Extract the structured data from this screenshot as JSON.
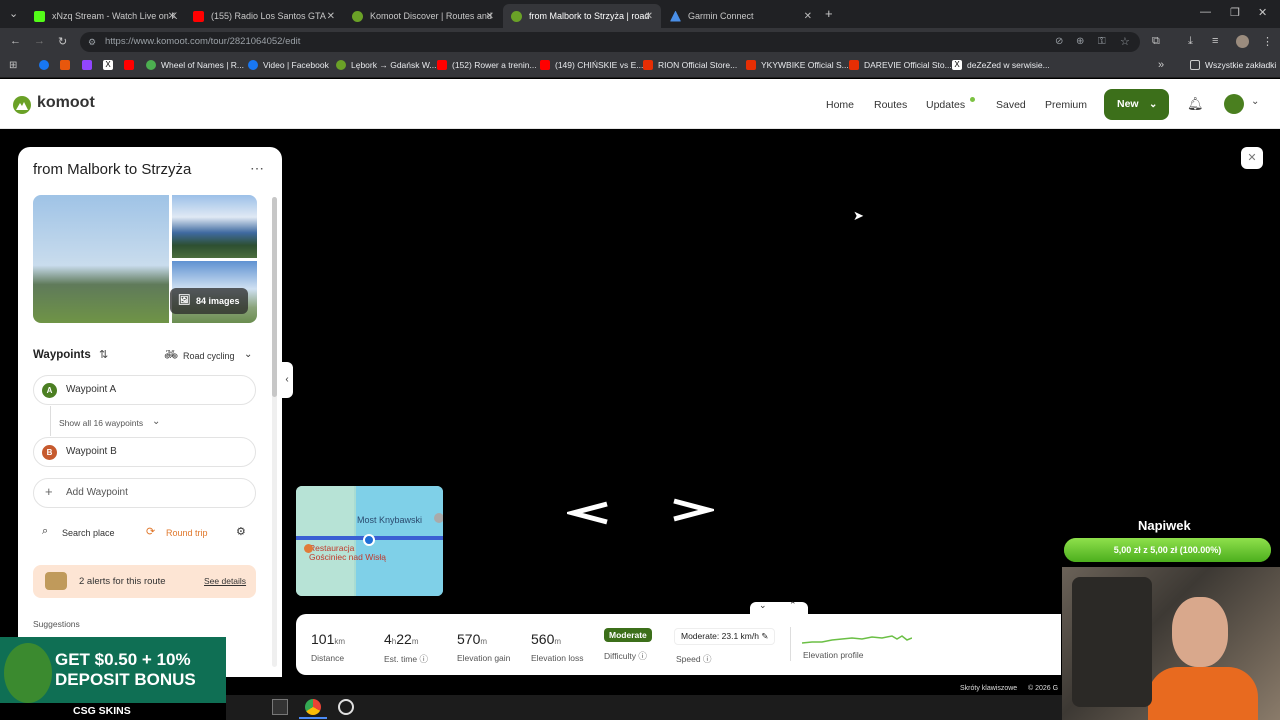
{
  "browser": {
    "tabs": [
      {
        "label": "xNzq Stream - Watch Live on K",
        "icon_color": "#53fc18"
      },
      {
        "label": "(155) Radio Los Santos GTA",
        "icon_color": "#ff0000"
      },
      {
        "label": "Komoot Discover | Routes and",
        "icon_color": "#6aa127"
      },
      {
        "label": "from Malbork to Strzyża | road",
        "icon_color": "#6aa127"
      },
      {
        "label": "Garmin Connect",
        "icon_color": "#4a8fe7"
      }
    ],
    "url": "https://www.komoot.com/tour/2821064052/edit",
    "bookmarks": [
      {
        "label": "",
        "icon_color": "#1877f2"
      },
      {
        "label": "",
        "icon_color": "#e8570c"
      },
      {
        "label": "",
        "icon_color": "#9146ff"
      },
      {
        "label": "",
        "icon_color": "#ffffff"
      },
      {
        "label": "Wheel of Names | R...",
        "icon_color": "#4caf50"
      },
      {
        "label": "Video | Facebook",
        "icon_color": "#1877f2"
      },
      {
        "label": "Lębork → Gdańsk W...",
        "icon_color": "#6aa127"
      },
      {
        "label": "(152) Rower a trenin...",
        "icon_color": "#ff0000"
      },
      {
        "label": "(149) CHIŃSKIE vs E...",
        "icon_color": "#ff0000"
      },
      {
        "label": "RION Official Store...",
        "icon_color": "#e62e04"
      },
      {
        "label": "YKYWBIKE Official S...",
        "icon_color": "#e62e04"
      },
      {
        "label": "DAREVIE Official Sto...",
        "icon_color": "#e62e04"
      },
      {
        "label": "deZeZed w serwisie...",
        "icon_color": "#ffffff"
      }
    ],
    "all_bookmarks": "Wszystkie zakładki"
  },
  "app": {
    "brand": "komoot",
    "nav": [
      "Home",
      "Routes",
      "Updates",
      "Saved",
      "Premium"
    ],
    "new_label": "New",
    "accent": "#3c6f1a"
  },
  "tour": {
    "title": "from Malbork to Strzyża",
    "images_label": "84 images",
    "waypoints_heading": "Waypoints",
    "sport": "Road cycling",
    "waypoint_a": "Waypoint A",
    "waypoint_a_marker": "A",
    "show_all": "Show all 16 waypoints",
    "waypoint_b": "Waypoint B",
    "waypoint_b_marker": "B",
    "add_waypoint": "Add Waypoint",
    "search_place": "Search place",
    "round_trip": "Round trip",
    "alerts": "2 alerts for this route",
    "see_details": "See details",
    "suggestions": "Suggestions"
  },
  "map": {
    "label1": "Most Knybawski",
    "label2": "Restauracja",
    "label3": "Gościniec nad Wisłą"
  },
  "stats": {
    "distance_value": "101",
    "distance_unit": "km",
    "distance_label": "Distance",
    "time_h": "4",
    "time_h_unit": "h",
    "time_m": "22",
    "time_m_unit": "m",
    "time_label": "Est. time",
    "gain_value": "570",
    "gain_unit": "m",
    "gain_label": "Elevation gain",
    "loss_value": "560",
    "loss_unit": "m",
    "loss_label": "Elevation loss",
    "difficulty_badge": "Moderate",
    "difficulty_label": "Difficulty",
    "speed_value": "Moderate: 23.1 km/h",
    "speed_label": "Speed",
    "elevation_label": "Elevation profile"
  },
  "footer": {
    "shortcuts": "Skróty klawiszowe",
    "copyright": "© 2026 G"
  },
  "overlay": {
    "donation_title": "Napiwek",
    "donation_text": "5,00 zł z 5,00 zł (100.00%)",
    "donation_progress": 1.0,
    "ad_line1": "GET $0.50 + 10%",
    "ad_line2": "DEPOSIT BONUS",
    "ad_brand": "CSG SKINS"
  }
}
